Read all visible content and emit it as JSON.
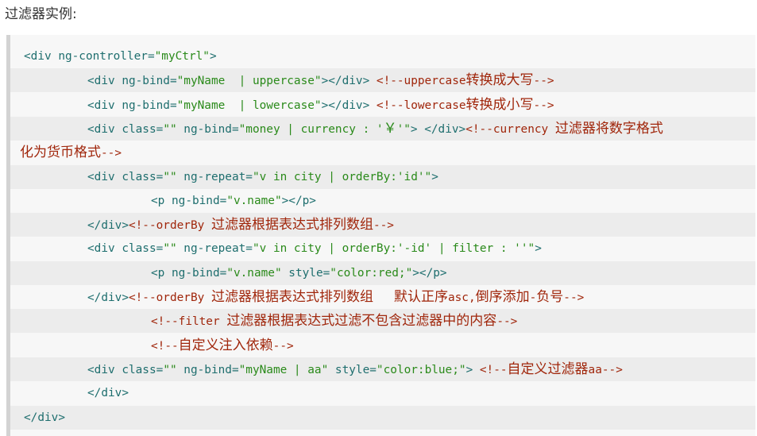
{
  "heading": "过滤器实例:",
  "lines": [
    {
      "indent": 0,
      "alt": false,
      "tokens": [
        {
          "t": "<div ng-controller=",
          "c": "tag"
        },
        {
          "t": "\"myCtrl\"",
          "c": "str"
        },
        {
          "t": ">",
          "c": "tag"
        }
      ]
    },
    {
      "indent": 1,
      "alt": true,
      "tokens": [
        {
          "t": "<div ng-bind=",
          "c": "tag"
        },
        {
          "t": "\"myName  | uppercase\"",
          "c": "str"
        },
        {
          "t": "></div> ",
          "c": "tag"
        },
        {
          "t": "<!--uppercase",
          "c": "cmt"
        },
        {
          "t": "转换成大写",
          "c": "cmt",
          "cjk": true
        },
        {
          "t": "-->",
          "c": "cmt"
        }
      ]
    },
    {
      "indent": 1,
      "alt": false,
      "tokens": [
        {
          "t": "<div ng-bind=",
          "c": "tag"
        },
        {
          "t": "\"myName  | lowercase\"",
          "c": "str"
        },
        {
          "t": "></div> ",
          "c": "tag"
        },
        {
          "t": "<!--lowercase",
          "c": "cmt"
        },
        {
          "t": "转换成小写",
          "c": "cmt",
          "cjk": true
        },
        {
          "t": "-->",
          "c": "cmt"
        }
      ]
    },
    {
      "indent": 1,
      "alt": true,
      "tokens": [
        {
          "t": "<div class=",
          "c": "tag"
        },
        {
          "t": "\"\"",
          "c": "str"
        },
        {
          "t": " ng-bind=",
          "c": "tag"
        },
        {
          "t": "\"money | currency : '",
          "c": "str"
        },
        {
          "t": "￥",
          "c": "str",
          "cjk": true
        },
        {
          "t": "'\"",
          "c": "str"
        },
        {
          "t": "> </div>",
          "c": "tag"
        },
        {
          "t": "<!--currency ",
          "c": "cmt"
        },
        {
          "t": "过滤器将数字格式",
          "c": "cmt",
          "cjk": true
        }
      ]
    },
    {
      "indent": -1,
      "alt": false,
      "tokens": [
        {
          "t": "化为货币格式",
          "c": "cmt",
          "cjk": true
        },
        {
          "t": "-->",
          "c": "cmt"
        }
      ]
    },
    {
      "indent": 1,
      "alt": true,
      "tokens": [
        {
          "t": "<div class=",
          "c": "tag"
        },
        {
          "t": "\"\"",
          "c": "str"
        },
        {
          "t": " ng-repeat=",
          "c": "tag"
        },
        {
          "t": "\"v in city | orderBy:'id'\"",
          "c": "str"
        },
        {
          "t": ">",
          "c": "tag"
        }
      ]
    },
    {
      "indent": 2,
      "alt": false,
      "tokens": [
        {
          "t": "<p ng-bind=",
          "c": "tag"
        },
        {
          "t": "\"v.name\"",
          "c": "str"
        },
        {
          "t": "></p>",
          "c": "tag"
        }
      ]
    },
    {
      "indent": 1,
      "alt": true,
      "tokens": [
        {
          "t": "</div>",
          "c": "tag"
        },
        {
          "t": "<!--orderBy ",
          "c": "cmt"
        },
        {
          "t": "过滤器根据表达式排列数组",
          "c": "cmt",
          "cjk": true
        },
        {
          "t": "-->",
          "c": "cmt"
        }
      ]
    },
    {
      "indent": 1,
      "alt": false,
      "tokens": [
        {
          "t": "<div class=",
          "c": "tag"
        },
        {
          "t": "\"\"",
          "c": "str"
        },
        {
          "t": " ng-repeat=",
          "c": "tag"
        },
        {
          "t": "\"v in city | orderBy:'-id' | filter : ''\"",
          "c": "str"
        },
        {
          "t": ">",
          "c": "tag"
        }
      ]
    },
    {
      "indent": 2,
      "alt": true,
      "tokens": [
        {
          "t": "<p ng-bind=",
          "c": "tag"
        },
        {
          "t": "\"v.name\"",
          "c": "str"
        },
        {
          "t": " style=",
          "c": "tag"
        },
        {
          "t": "\"color:red;\"",
          "c": "str"
        },
        {
          "t": "></p>",
          "c": "tag"
        }
      ]
    },
    {
      "indent": 1,
      "alt": false,
      "tokens": [
        {
          "t": "</div>",
          "c": "tag"
        },
        {
          "t": "<!--orderBy ",
          "c": "cmt"
        },
        {
          "t": "过滤器根据表达式排列数组",
          "c": "cmt",
          "cjk": true
        },
        {
          "t": "   ",
          "c": "cmt"
        },
        {
          "t": "默认正序",
          "c": "cmt",
          "cjk": true
        },
        {
          "t": "asc,",
          "c": "cmt"
        },
        {
          "t": "倒序添加",
          "c": "cmt",
          "cjk": true
        },
        {
          "t": "-",
          "c": "cmt"
        },
        {
          "t": "负号",
          "c": "cmt",
          "cjk": true
        },
        {
          "t": "-->",
          "c": "cmt"
        }
      ]
    },
    {
      "indent": 2,
      "alt": true,
      "tokens": [
        {
          "t": "<!--filter ",
          "c": "cmt"
        },
        {
          "t": "过滤器根据表达式过滤不包含过滤器中的内容",
          "c": "cmt",
          "cjk": true
        },
        {
          "t": "-->",
          "c": "cmt"
        }
      ]
    },
    {
      "indent": 2,
      "alt": false,
      "tokens": [
        {
          "t": "<!--",
          "c": "cmt"
        },
        {
          "t": "自定义注入依赖",
          "c": "cmt",
          "cjk": true
        },
        {
          "t": "-->",
          "c": "cmt"
        }
      ]
    },
    {
      "indent": 1,
      "alt": true,
      "tokens": [
        {
          "t": "<div class=",
          "c": "tag"
        },
        {
          "t": "\"\"",
          "c": "str"
        },
        {
          "t": " ng-bind=",
          "c": "tag"
        },
        {
          "t": "\"myName | aa\"",
          "c": "str"
        },
        {
          "t": " style=",
          "c": "tag"
        },
        {
          "t": "\"color:blue;\"",
          "c": "str"
        },
        {
          "t": "> ",
          "c": "tag"
        },
        {
          "t": "<!--",
          "c": "cmt"
        },
        {
          "t": "自定义过滤器",
          "c": "cmt",
          "cjk": true
        },
        {
          "t": "aa-->",
          "c": "cmt"
        }
      ]
    },
    {
      "indent": 1,
      "alt": false,
      "tokens": [
        {
          "t": "</div>",
          "c": "tag"
        }
      ]
    },
    {
      "indent": 0,
      "alt": true,
      "tokens": [
        {
          "t": "</div>",
          "c": "tag"
        }
      ]
    }
  ]
}
